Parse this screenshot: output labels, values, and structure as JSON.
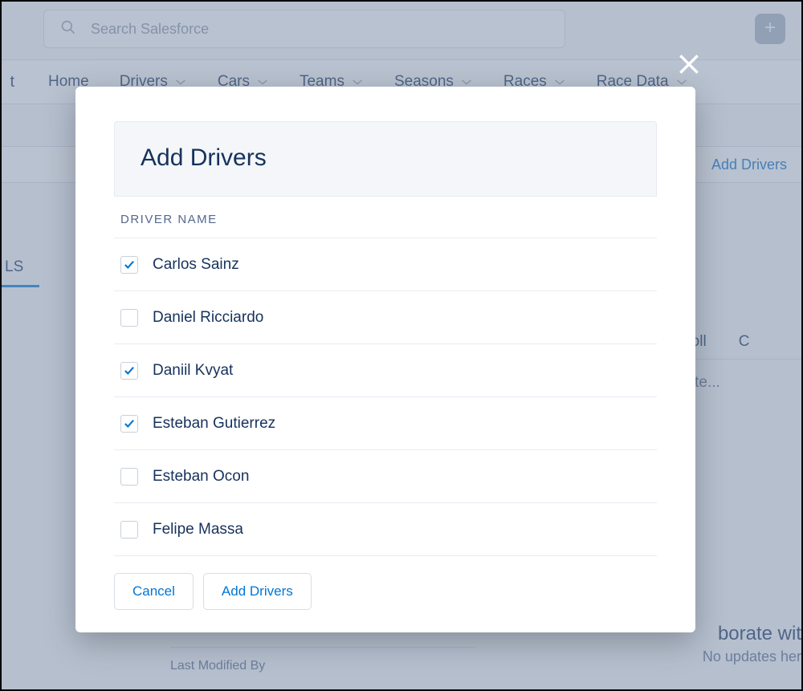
{
  "search": {
    "placeholder": "Search Salesforce"
  },
  "nav": {
    "truncated_prefix": "t",
    "items": [
      {
        "label": "Home",
        "has_dropdown": false
      },
      {
        "label": "Drivers",
        "has_dropdown": true
      },
      {
        "label": "Cars",
        "has_dropdown": true
      },
      {
        "label": "Teams",
        "has_dropdown": true
      },
      {
        "label": "Seasons",
        "has_dropdown": true
      },
      {
        "label": "Races",
        "has_dropdown": true
      },
      {
        "label": "Race Data",
        "has_dropdown": true
      }
    ]
  },
  "page": {
    "add_drivers_link": "Add Drivers",
    "left_tab_truncated": "LS",
    "right_tabs": [
      "Poll",
      "C"
    ],
    "update_placeholder": "date...",
    "bottom_right_heading": "borate wit",
    "bottom_right_sub": "No updates her",
    "last_modified_label": "Last Modified By"
  },
  "modal": {
    "title": "Add Drivers",
    "column_header": "DRIVER NAME",
    "drivers": [
      {
        "name": "Carlos Sainz",
        "checked": true
      },
      {
        "name": "Daniel Ricciardo",
        "checked": false
      },
      {
        "name": "Daniil Kvyat",
        "checked": true
      },
      {
        "name": "Esteban Gutierrez",
        "checked": true
      },
      {
        "name": "Esteban Ocon",
        "checked": false
      },
      {
        "name": "Felipe Massa",
        "checked": false
      }
    ],
    "cancel_label": "Cancel",
    "confirm_label": "Add Drivers"
  }
}
